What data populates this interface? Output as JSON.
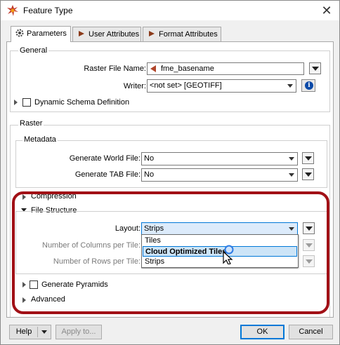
{
  "window": {
    "title": "Feature Type",
    "close_glyph": "✕"
  },
  "tabs": [
    {
      "label": "Parameters",
      "icon": "gear-icon",
      "active": true
    },
    {
      "label": "User Attributes",
      "icon": "arrow-right-icon",
      "active": false
    },
    {
      "label": "Format Attributes",
      "icon": "arrow-right-icon",
      "active": false
    }
  ],
  "general": {
    "title": "General",
    "raster_file_name_label": "Raster File Name:",
    "raster_file_name_value": "fme_basename",
    "writer_label": "Writer:",
    "writer_value": "<not set> [GEOTIFF]",
    "info_glyph": "i",
    "dynamic_schema_label": "Dynamic Schema Definition"
  },
  "raster": {
    "title": "Raster",
    "metadata": {
      "title": "Metadata",
      "world_file_label": "Generate World File:",
      "world_file_value": "No",
      "tab_file_label": "Generate TAB File:",
      "tab_file_value": "No"
    },
    "compression_label": "Compression",
    "file_structure": {
      "title": "File Structure",
      "layout_label": "Layout:",
      "layout_value": "Strips",
      "columns_label": "Number of Columns per Tile:",
      "rows_label": "Number of Rows per Tile:",
      "layout_options": [
        "Tiles",
        "Cloud Optimized Tiles",
        "Strips"
      ]
    },
    "pyramids_label": "Generate Pyramids",
    "advanced_label": "Advanced"
  },
  "footer": {
    "help_label": "Help",
    "apply_label": "Apply to...",
    "ok_label": "OK",
    "cancel_label": "Cancel"
  },
  "colors": {
    "highlight": "#a11016",
    "focus": "#0078d7"
  }
}
